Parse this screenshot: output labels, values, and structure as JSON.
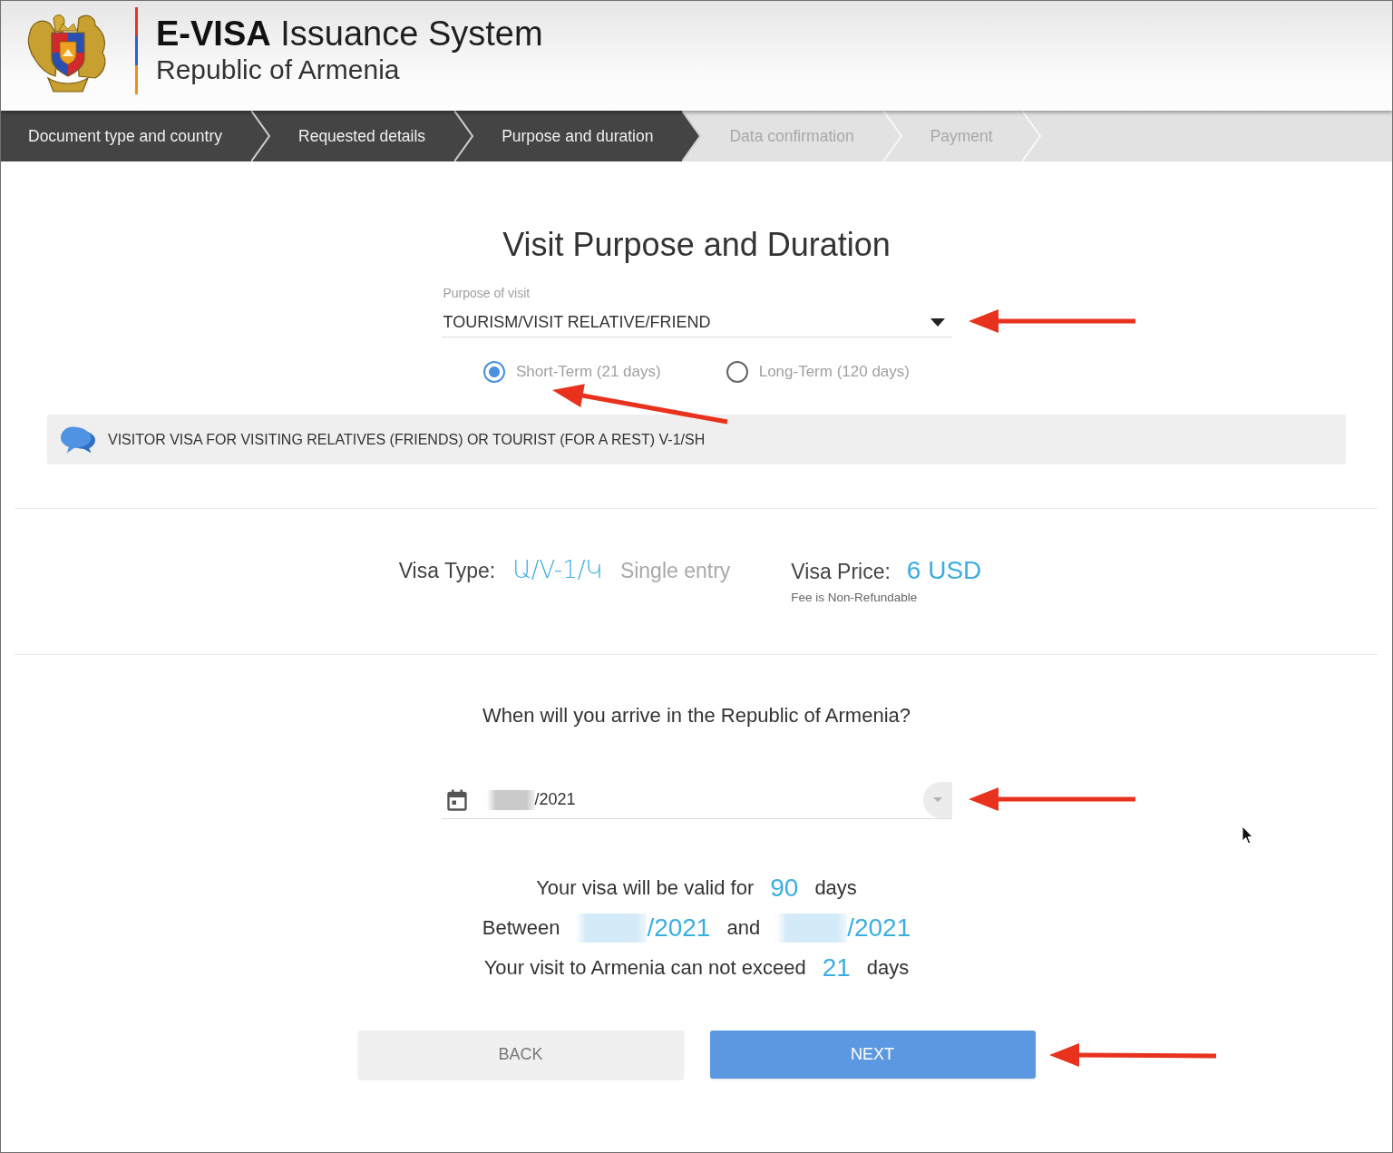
{
  "header": {
    "title": "**E-VISA** Issuance System",
    "subtitle": "Republic of Armenia"
  },
  "steps": [
    {
      "label": "Document type and country",
      "completed": true
    },
    {
      "label": "Requested details",
      "completed": true
    },
    {
      "label": "Purpose and duration",
      "completed": true
    },
    {
      "label": "Data confirmation",
      "completed": false
    },
    {
      "label": "Payment",
      "completed": false
    }
  ],
  "form": {
    "title": "Visit Purpose and Duration",
    "purpose_select": {
      "label": "Purpose of visit",
      "value": "TOURISM/VISIT RELATIVE/FRIEND"
    },
    "term_options": [
      {
        "label": "Short-Term (21 days)",
        "selected": true
      },
      {
        "label": "Long-Term (120 days)",
        "selected": false
      }
    ],
    "info_banner": "VISITOR VISA FOR VISITING RELATIVES (FRIENDS) OR TOURIST (FOR A REST) V-1/SH"
  },
  "visa_summary": {
    "type_label": "Visa Type:",
    "type_code": "Ա/V-1/Կ",
    "entry": "Single entry",
    "price_label": "Visa Price:",
    "price": "6 USD",
    "price_note": "Fee is Non-Refundable"
  },
  "arrival": {
    "question": "When will you arrive in the Republic of Armenia?",
    "date_field": {
      "value": "/2021",
      "redacted": true
    }
  },
  "validity": [
    {
      "parts": [
        {
          "kind": "text",
          "text": "Your visa will be valid for"
        },
        {
          "kind": "value",
          "text": "90"
        },
        {
          "kind": "text",
          "text": "days"
        }
      ]
    },
    {
      "parts": [
        {
          "kind": "text",
          "text": "Between"
        },
        {
          "kind": "redacted_date",
          "text": "/2021"
        },
        {
          "kind": "text",
          "text": "and"
        },
        {
          "kind": "redacted_date",
          "text": "/2021"
        }
      ]
    },
    {
      "parts": [
        {
          "kind": "text",
          "text": "Your visit to Armenia can not exceed"
        },
        {
          "kind": "value",
          "text": "21"
        },
        {
          "kind": "text",
          "text": "days"
        }
      ]
    }
  ],
  "buttons": [
    {
      "label": "BACK",
      "kind": "secondary"
    },
    {
      "label": "NEXT",
      "kind": "primary"
    }
  ]
}
